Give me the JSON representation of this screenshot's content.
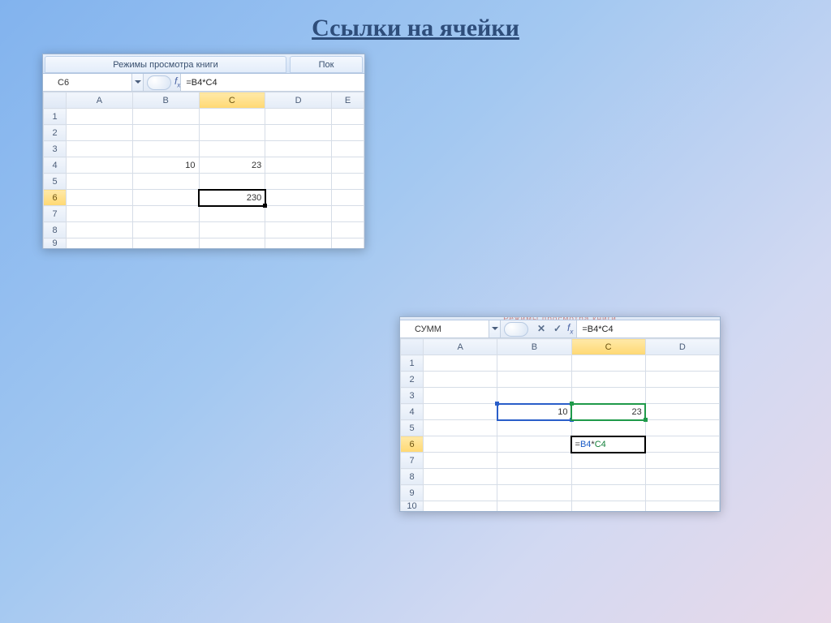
{
  "slide": {
    "title": "Ссылки на ячейки"
  },
  "panel1": {
    "ribbon_tab_main": "Режимы просмотра книги",
    "ribbon_tab_cut": "Пок",
    "namebox": "C6",
    "formula": "=B4*C4",
    "columns": [
      "A",
      "B",
      "C",
      "D",
      "E"
    ],
    "rows": [
      "1",
      "2",
      "3",
      "4",
      "5",
      "6",
      "7",
      "8",
      "9"
    ],
    "cells": {
      "B4": "10",
      "C4": "23",
      "C6": "230"
    },
    "active_col": "C",
    "active_row": "6"
  },
  "panel2": {
    "faded_tab": "Режимы просмотра книги",
    "namebox": "СУММ",
    "formula": "=B4*C4",
    "columns": [
      "A",
      "B",
      "C",
      "D"
    ],
    "rows": [
      "1",
      "2",
      "3",
      "4",
      "5",
      "6",
      "7",
      "8",
      "9",
      "10"
    ],
    "cells": {
      "B4": "10",
      "C4": "23"
    },
    "edit_prefix": "=",
    "edit_ref1": "B4",
    "edit_op": "*",
    "edit_ref2": "C4",
    "active_col": "C",
    "active_row": "6"
  }
}
